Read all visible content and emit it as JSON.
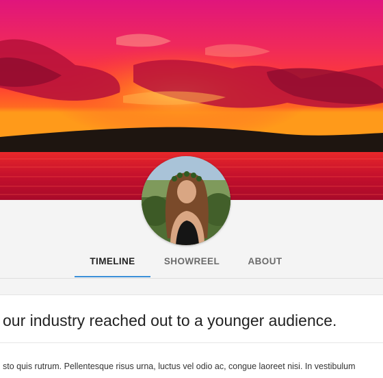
{
  "cover": {
    "colors": {
      "sky_top": "#e2187a",
      "sky_mid": "#ff3a45",
      "horizon": "#ff8a1f",
      "water": "#c8102e",
      "land": "#1c1410"
    }
  },
  "profile": {
    "avatar_icon": "profile-photo"
  },
  "tabs": [
    {
      "label": "TIMELINE",
      "active": true
    },
    {
      "label": "SHOWREEL",
      "active": false
    },
    {
      "label": "ABOUT",
      "active": false
    }
  ],
  "accent_color": "#3a8fd8",
  "post": {
    "title": "our industry reached out to a younger audience.",
    "body": "sto quis rutrum. Pellentesque risus urna, luctus vel odio ac, congue laoreet nisi. In vestibulum"
  }
}
